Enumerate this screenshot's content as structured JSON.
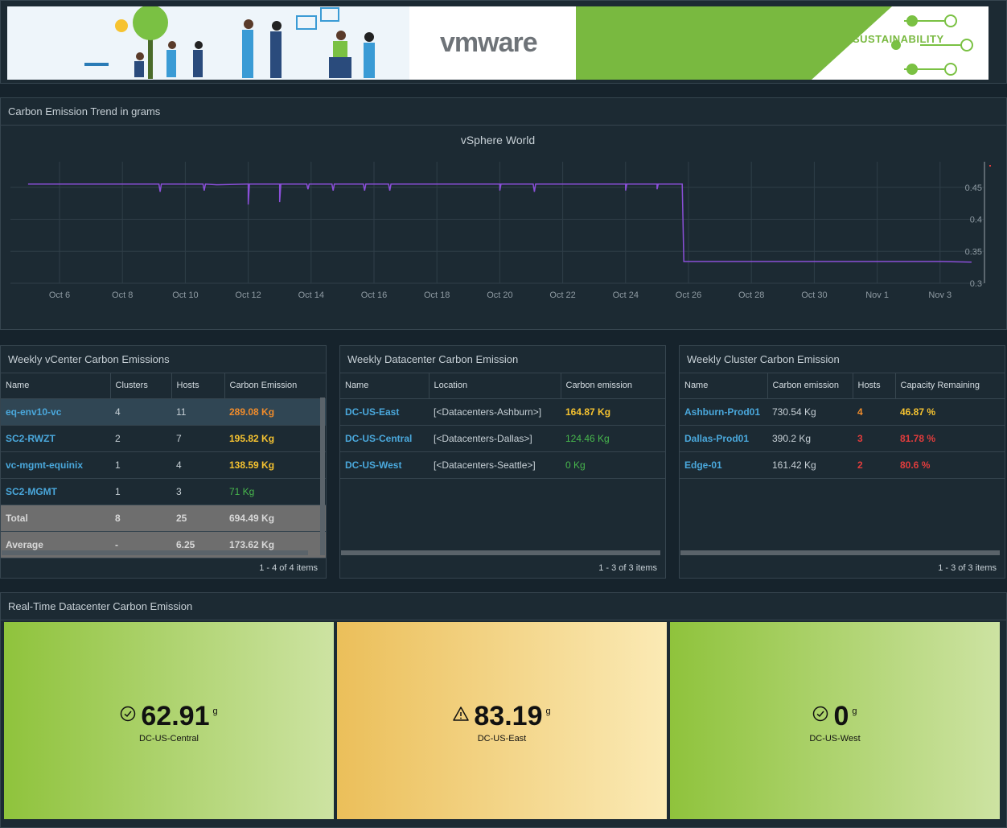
{
  "banner": {
    "logo": "vmware",
    "tag": "SUSTAINABILITY"
  },
  "trend": {
    "panel_title": "Carbon Emission Trend in grams",
    "chart_title": "vSphere World"
  },
  "chart_data": {
    "type": "line",
    "title": "vSphere World",
    "x_ticks": [
      "Oct 6",
      "Oct 8",
      "Oct 10",
      "Oct 12",
      "Oct 14",
      "Oct 16",
      "Oct 18",
      "Oct 20",
      "Oct 22",
      "Oct 24",
      "Oct 26",
      "Oct 28",
      "Oct 30",
      "Nov 1",
      "Nov 3"
    ],
    "y_ticks": [
      "0.45",
      "0.4",
      "0.35",
      "0.3"
    ],
    "ylim": [
      0.3,
      0.49
    ],
    "series": [
      {
        "color": "#8a4fd8",
        "x": [
          "Oct 5",
          "Oct 6",
          "Oct 7",
          "Oct 8",
          "Oct 9",
          "Oct 10",
          "Oct 11",
          "Oct 12",
          "Oct 13",
          "Oct 14",
          "Oct 15",
          "Oct 16",
          "Oct 17",
          "Oct 18",
          "Oct 19",
          "Oct 20",
          "Oct 21",
          "Oct 22",
          "Oct 23",
          "Oct 24",
          "Oct 25",
          "Oct 26",
          "Oct 27",
          "Oct 28",
          "Oct 29",
          "Oct 30",
          "Oct 31",
          "Nov 1",
          "Nov 2",
          "Nov 3",
          "Nov 4"
        ],
        "y": [
          0.455,
          0.455,
          0.455,
          0.455,
          0.455,
          0.455,
          0.454,
          0.455,
          0.455,
          0.455,
          0.455,
          0.455,
          0.455,
          0.455,
          0.455,
          0.455,
          0.455,
          0.455,
          0.455,
          0.455,
          0.455,
          0.334,
          0.334,
          0.334,
          0.334,
          0.334,
          0.334,
          0.334,
          0.334,
          0.334,
          0.333
        ],
        "dips": [
          {
            "x": "Oct 9.2",
            "y": 0.443
          },
          {
            "x": "Oct 10.6",
            "y": 0.445
          },
          {
            "x": "Oct 12",
            "y": 0.423
          },
          {
            "x": "Oct 13",
            "y": 0.427
          },
          {
            "x": "Oct 13.9",
            "y": 0.447
          },
          {
            "x": "Oct 14.7",
            "y": 0.445
          },
          {
            "x": "Oct 15.7",
            "y": 0.445
          },
          {
            "x": "Oct 16.5",
            "y": 0.445
          },
          {
            "x": "Oct 20",
            "y": 0.445
          },
          {
            "x": "Oct 21.1",
            "y": 0.443
          },
          {
            "x": "Oct 24",
            "y": 0.445
          },
          {
            "x": "Oct 25",
            "y": 0.447
          }
        ]
      }
    ]
  },
  "vcenter": {
    "title": "Weekly vCenter Carbon Emissions",
    "columns": [
      "Name",
      "Clusters",
      "Hosts",
      "Carbon Emission"
    ],
    "rows": [
      {
        "name": "eq-env10-vc",
        "clusters": "4",
        "hosts": "11",
        "emission": "289.08 Kg",
        "level": "orange"
      },
      {
        "name": "SC2-RWZT",
        "clusters": "2",
        "hosts": "7",
        "emission": "195.82 Kg",
        "level": "yellow"
      },
      {
        "name": "vc-mgmt-equinix",
        "clusters": "1",
        "hosts": "4",
        "emission": "138.59 Kg",
        "level": "yellow"
      },
      {
        "name": "SC2-MGMT",
        "clusters": "1",
        "hosts": "3",
        "emission": "71 Kg",
        "level": "green"
      }
    ],
    "total": {
      "label": "Total",
      "clusters": "8",
      "hosts": "25",
      "emission": "694.49 Kg"
    },
    "average": {
      "label": "Average",
      "clusters": "-",
      "hosts": "6.25",
      "emission": "173.62 Kg"
    },
    "footer": "1 - 4 of 4 items"
  },
  "datacenter": {
    "title": "Weekly Datacenter Carbon Emission",
    "columns": [
      "Name",
      "Location",
      "Carbon emission"
    ],
    "rows": [
      {
        "name": "DC-US-East",
        "location": "[<Datacenters-Ashburn>]",
        "emission": "164.87 Kg",
        "level": "yellow"
      },
      {
        "name": "DC-US-Central",
        "location": "[<Datacenters-Dallas>]",
        "emission": "124.46 Kg",
        "level": "green"
      },
      {
        "name": "DC-US-West",
        "location": "[<Datacenters-Seattle>]",
        "emission": "0 Kg",
        "level": "green"
      }
    ],
    "footer": "1 - 3 of 3 items"
  },
  "cluster": {
    "title": "Weekly Cluster Carbon Emission",
    "columns": [
      "Name",
      "Carbon emission",
      "Hosts",
      "Capacity Remaining"
    ],
    "rows": [
      {
        "name": "Ashburn-Prod01",
        "emission": "730.54 Kg",
        "hosts": "4",
        "capacity": "46.87 %",
        "hosts_level": "orange",
        "cap_level": "yellow"
      },
      {
        "name": "Dallas-Prod01",
        "emission": "390.2 Kg",
        "hosts": "3",
        "capacity": "81.78 %",
        "hosts_level": "red",
        "cap_level": "red"
      },
      {
        "name": "Edge-01",
        "emission": "161.42 Kg",
        "hosts": "2",
        "capacity": "80.6 %",
        "hosts_level": "red",
        "cap_level": "red"
      }
    ],
    "footer": "1 - 3 of 3 items"
  },
  "realtime": {
    "title": "Real-Time Datacenter Carbon Emission",
    "tiles": [
      {
        "value": "62.91",
        "unit": "g",
        "label": "DC-US-Central",
        "status": "ok",
        "icon": "check-circle-icon"
      },
      {
        "value": "83.19",
        "unit": "g",
        "label": "DC-US-East",
        "status": "warning",
        "icon": "warning-triangle-icon"
      },
      {
        "value": "0",
        "unit": "g",
        "label": "DC-US-West",
        "status": "ok",
        "icon": "check-circle-icon"
      }
    ]
  }
}
